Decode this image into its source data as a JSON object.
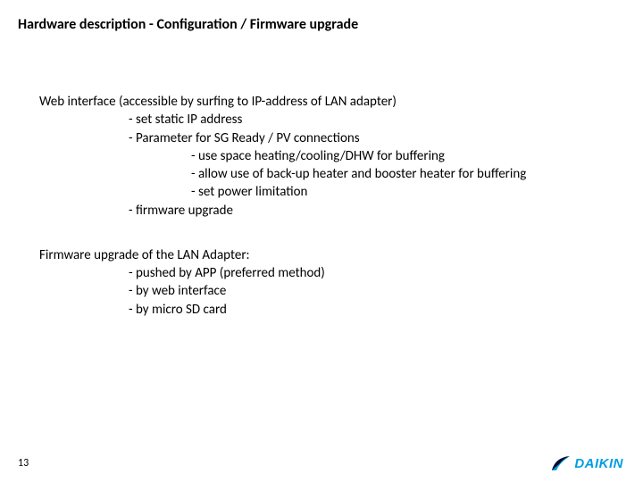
{
  "title": "Hardware description - Configuration / Firmware upgrade",
  "section1": {
    "heading": "Web interface (accessible by surfing to IP-address of LAN adapter)",
    "i1": "- set static IP address",
    "i2": "- Parameter for SG Ready / PV connections",
    "i2a": "- use space heating/cooling/DHW for buffering",
    "i2b": "- allow use of back-up heater and booster heater for buffering",
    "i2c": "- set power limitation",
    "i3": "- firmware upgrade"
  },
  "section2": {
    "heading": "Firmware upgrade of the LAN Adapter:",
    "i1": "- pushed by APP (preferred method)",
    "i2": "- by web interface",
    "i3": "- by micro SD card"
  },
  "page_number": "13",
  "brand": {
    "name": "DAIKIN",
    "color": "#009ee0"
  }
}
